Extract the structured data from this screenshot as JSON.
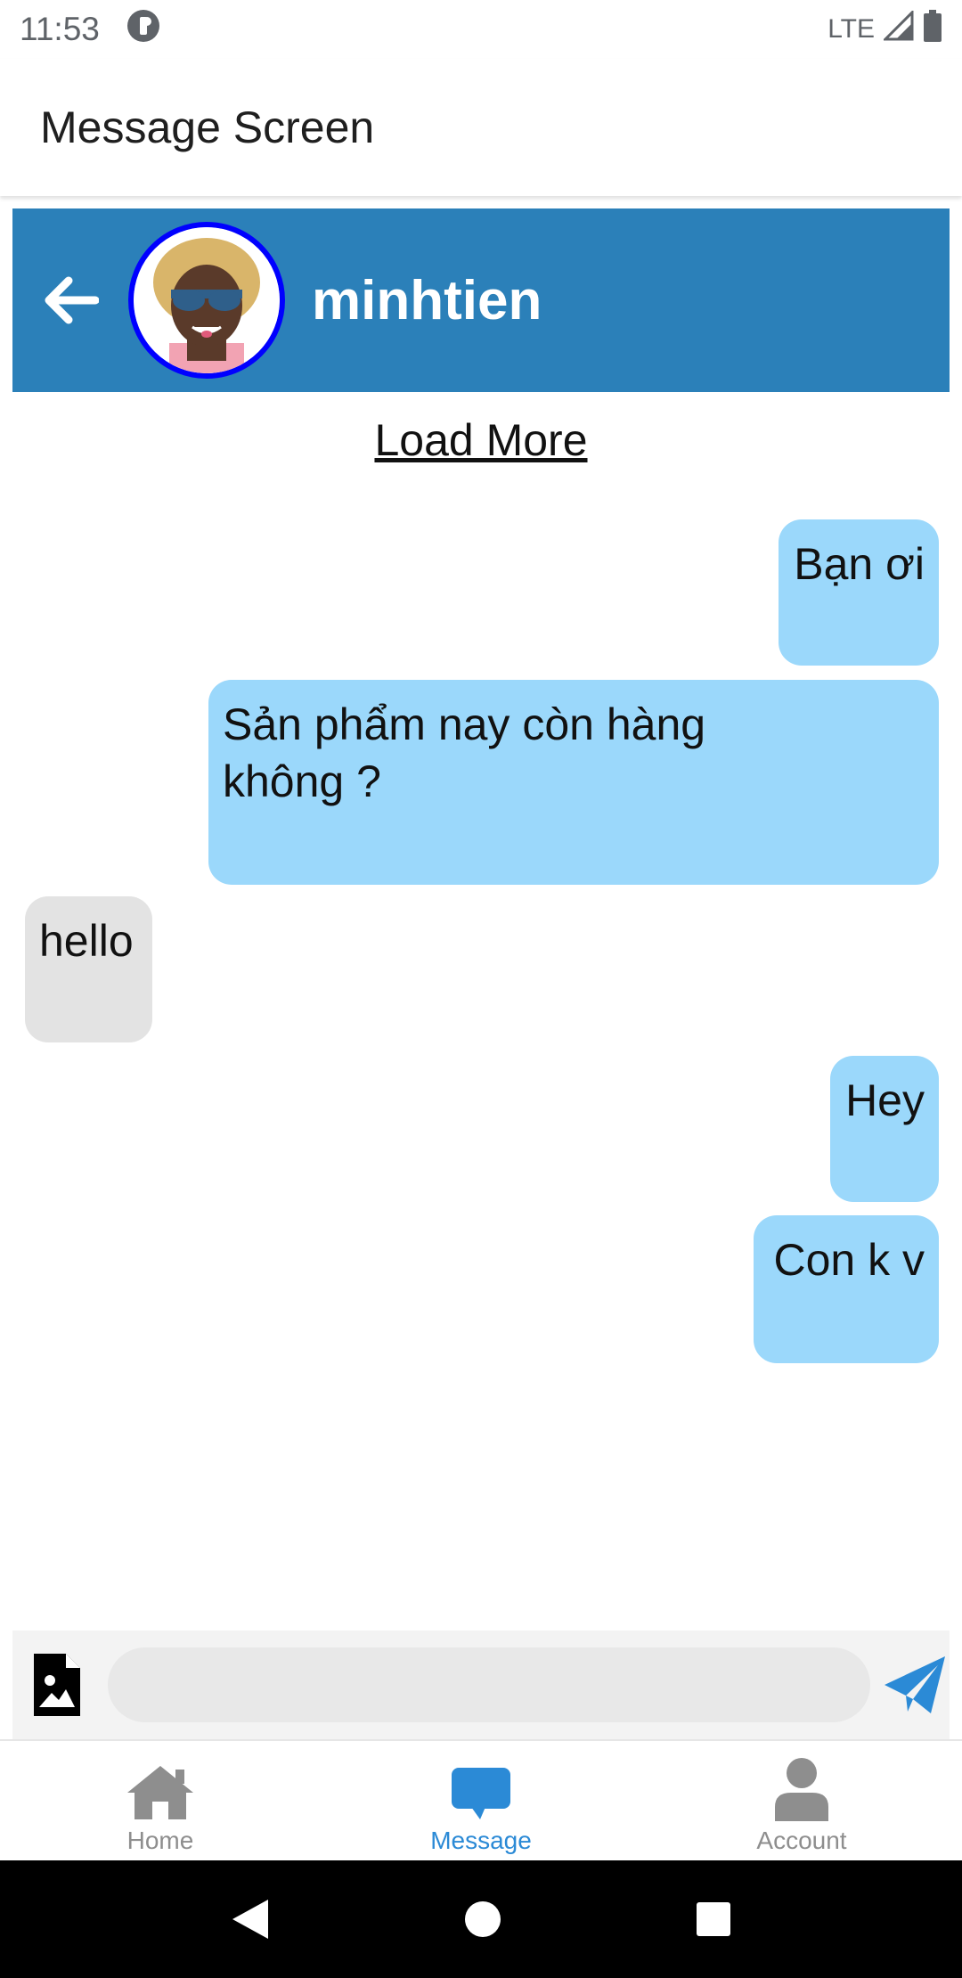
{
  "status_bar": {
    "time": "11:53",
    "network": "LTE"
  },
  "app_bar": {
    "title": "Message Screen"
  },
  "chat_header": {
    "contact_name": "minhtien"
  },
  "load_more": "Load More",
  "messages": [
    {
      "text": "Bạn ơi",
      "from": "me"
    },
    {
      "text": "Sản phẩm nay còn hàng không ?",
      "from": "me"
    },
    {
      "text": "hello",
      "from": "them"
    },
    {
      "text": "Hey",
      "from": "me"
    },
    {
      "text": "Con k v",
      "from": "me"
    }
  ],
  "composer": {
    "placeholder": "",
    "attach_icon": "image-file-icon",
    "send_icon": "send-icon"
  },
  "tabs": [
    {
      "label": "Home",
      "icon": "home-icon",
      "active": false
    },
    {
      "label": "Message",
      "icon": "chat-bubble-icon",
      "active": true
    },
    {
      "label": "Account",
      "icon": "person-icon",
      "active": false
    }
  ],
  "colors": {
    "header_blue": "#2b80b9",
    "my_bubble": "#9bd8fb",
    "their_bubble": "#e3e3e3",
    "active_tab": "#2b8ad6",
    "avatar_border": "#0000ff"
  }
}
